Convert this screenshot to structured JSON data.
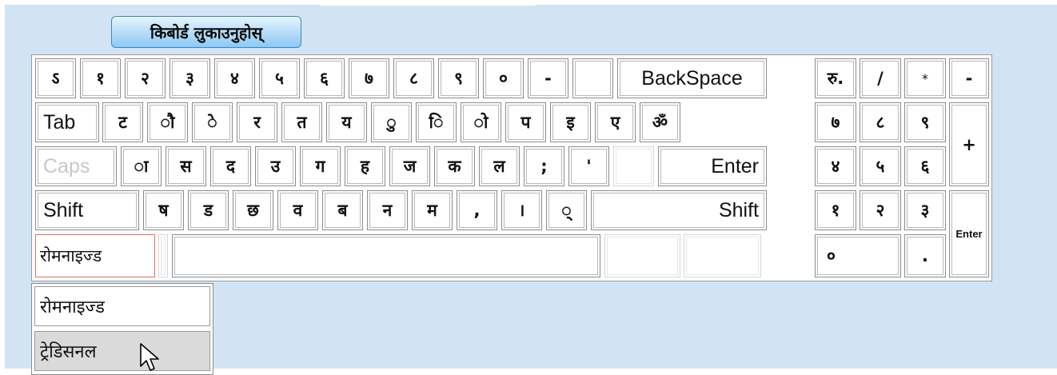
{
  "toolbar": {
    "hide_keyboard_label": "किबोर्ड लुकाउनुहोस्"
  },
  "keyboard": {
    "row1": [
      "ऽ",
      "१",
      "२",
      "३",
      "४",
      "५",
      "६",
      "७",
      "८",
      "९",
      "०",
      "-",
      "",
      "BackSpace"
    ],
    "row2": [
      "Tab",
      "ट",
      "ौ",
      "े",
      "र",
      "त",
      "य",
      "ु",
      "ि",
      "ो",
      "प",
      "इ",
      "ए",
      "ॐ"
    ],
    "row3": [
      "Caps",
      "ा",
      "स",
      "द",
      "उ",
      "ग",
      "ह",
      "ज",
      "क",
      "ल",
      ";",
      "'",
      "",
      "Enter"
    ],
    "row4": [
      "Shift",
      "ष",
      "ड",
      "छ",
      "व",
      "ब",
      "न",
      "म",
      ",",
      "।",
      "्",
      "Shift"
    ],
    "row5": [
      "रोमनाइज्ड",
      "",
      "",
      "",
      "",
      ""
    ]
  },
  "numpad": {
    "row1": [
      "रु.",
      "/",
      "*",
      "-"
    ],
    "row2": [
      "७",
      "८",
      "९",
      "+"
    ],
    "row3": [
      "४",
      "५",
      "६"
    ],
    "row4": [
      "१",
      "२",
      "३",
      "Enter"
    ],
    "row5": [
      "०",
      "."
    ]
  },
  "layout_dropdown": {
    "options": [
      "रोमनाइज्ड",
      "ट्रेडिसनल"
    ],
    "hovered": "ट्रेडिसनल"
  }
}
